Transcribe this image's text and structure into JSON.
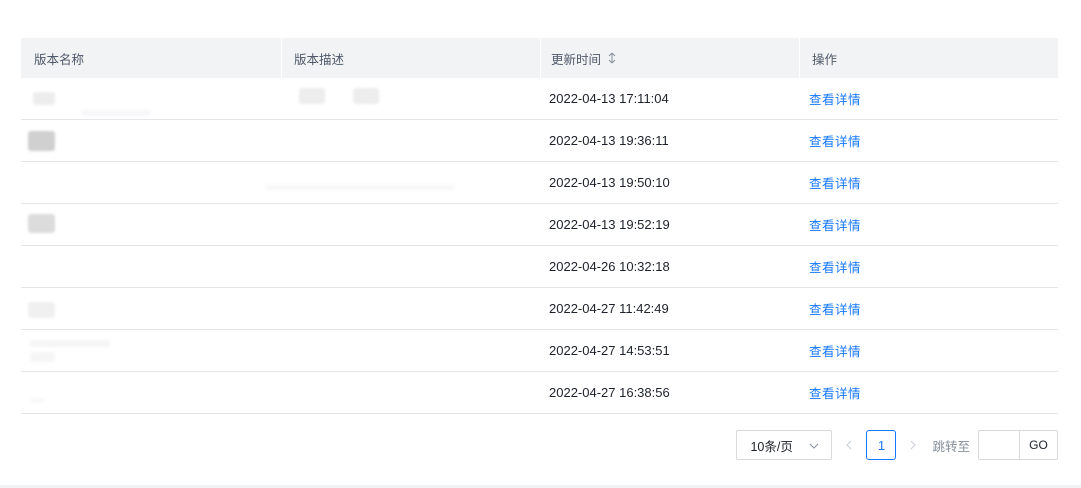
{
  "table": {
    "columns": {
      "name": "版本名称",
      "description": "版本描述",
      "updated": "更新时间",
      "action": "操作"
    },
    "rows": [
      {
        "updated": "2022-04-13 17:11:04",
        "action": "查看详情"
      },
      {
        "updated": "2022-04-13 19:36:11",
        "action": "查看详情"
      },
      {
        "updated": "2022-04-13 19:50:10",
        "action": "查看详情"
      },
      {
        "updated": "2022-04-13 19:52:19",
        "action": "查看详情"
      },
      {
        "updated": "2022-04-26 10:32:18",
        "action": "查看详情"
      },
      {
        "updated": "2022-04-27 11:42:49",
        "action": "查看详情"
      },
      {
        "updated": "2022-04-27 14:53:51",
        "action": "查看详情"
      },
      {
        "updated": "2022-04-27 16:38:56",
        "action": "查看详情"
      }
    ]
  },
  "pagination": {
    "page_size": "10条/页",
    "current_page": "1",
    "jump_label": "跳转至",
    "go_label": "GO"
  },
  "colors": {
    "accent": "#1677ff",
    "header_bg": "#f2f3f5",
    "row_border": "#e5e6eb"
  },
  "icons": {
    "sort": "sort-arrows-icon",
    "select": "chevron-down-icon",
    "prev": "chevron-left-icon",
    "next": "chevron-right-icon"
  }
}
